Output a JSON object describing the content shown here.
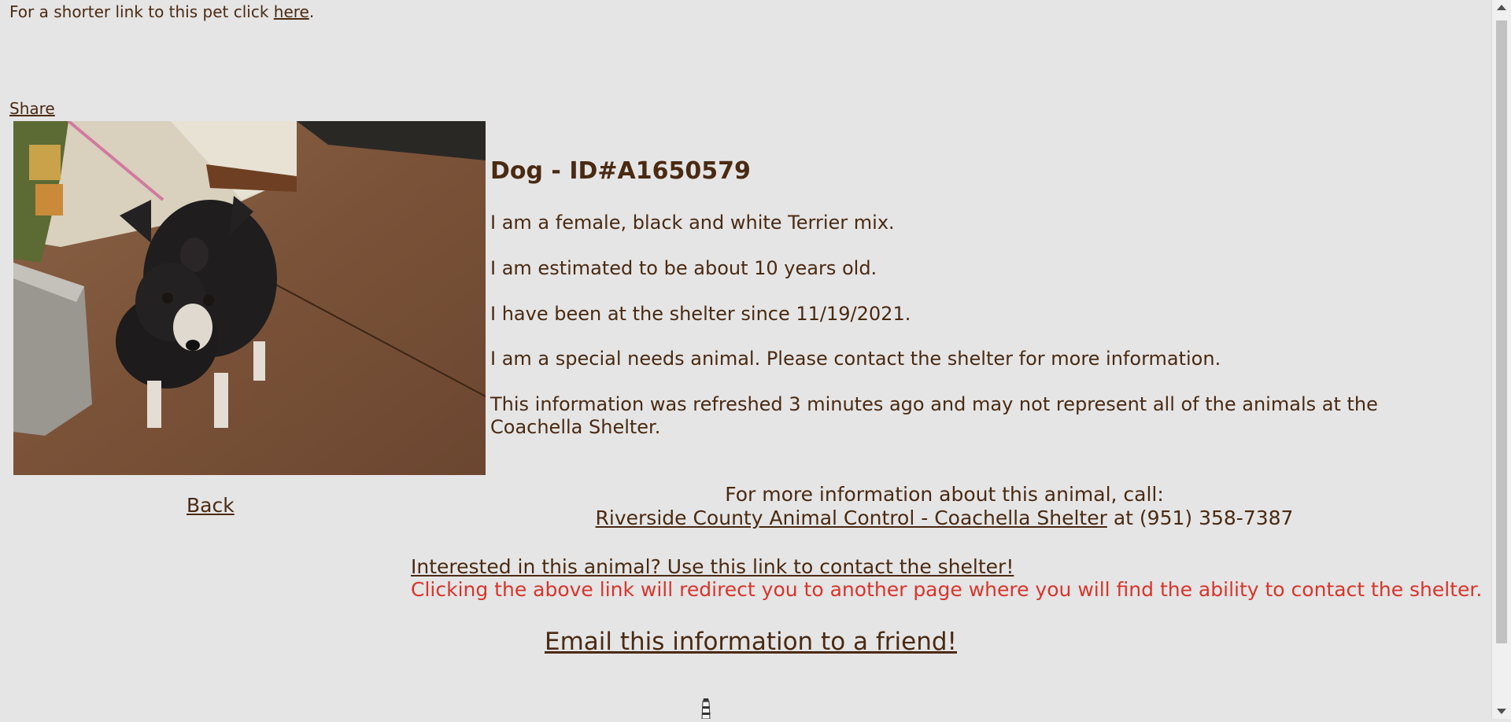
{
  "header": {
    "short_link_prefix": "For a shorter link to this pet click ",
    "short_link_label": "here",
    "short_link_suffix": ".",
    "share_label": "Share"
  },
  "pet": {
    "title": "Dog - ID#A1650579",
    "info": [
      "I am a female, black and white Terrier mix.",
      "I am estimated to be about 10 years old.",
      "I have been at the shelter since 11/19/2021.",
      "I am a special needs animal. Please contact the shelter for more information."
    ],
    "refresh_note": "This information was refreshed 3 minutes ago and may not represent all of the animals at the Coachella Shelter."
  },
  "nav": {
    "back_label": "Back"
  },
  "contact": {
    "intro": "For more information about this animal, call:",
    "shelter_name": "Riverside County Animal Control - Coachella Shelter",
    "phone_text": " at (951) 358-7387",
    "interested_label": "Interested in this animal? Use this link to contact the shelter!",
    "redirect_note": "Clicking the above link will redirect you to another page where you will find the ability to contact the shelter.",
    "email_label": "Email this information to a friend!"
  },
  "colors": {
    "background": "#e5e5e5",
    "text": "#4a2a12",
    "warning": "#d9342b"
  },
  "icons": {
    "loader": "lighthouse-icon"
  }
}
